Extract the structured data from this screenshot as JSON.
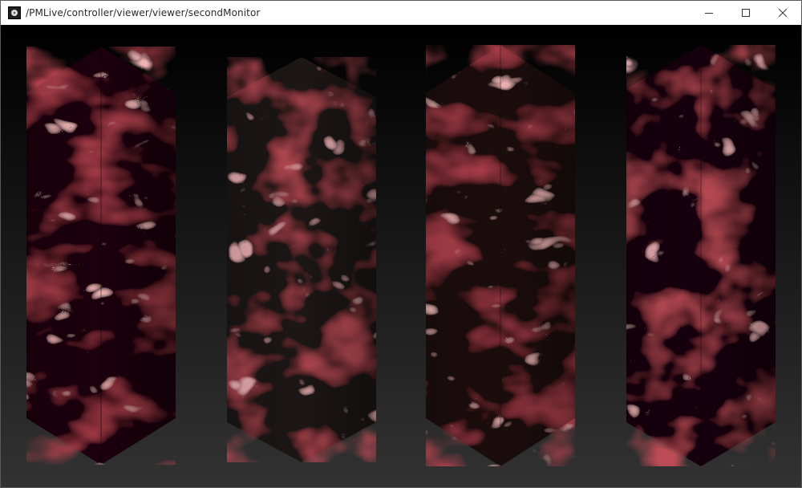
{
  "window": {
    "title": "/PMLive/controller/viewer/viewer/secondMonitor",
    "app_icon": "app-icon",
    "controls": [
      {
        "name": "minimize-button",
        "icon": "minimize-icon"
      },
      {
        "name": "maximize-button",
        "icon": "maximize-icon"
      },
      {
        "name": "close-button",
        "icon": "close-icon"
      }
    ]
  },
  "viewport": {
    "content": "4 marbled red/black hexagonal prism panels",
    "panel_count": 4,
    "colors": {
      "bg_top": "#000000",
      "bg_bottom": "#323232",
      "panel_dark": "#1a0508",
      "panel_red": "#8c1c24",
      "panel_highlight": "#d87c7c",
      "panel_teal": "#1c2a2d"
    }
  }
}
